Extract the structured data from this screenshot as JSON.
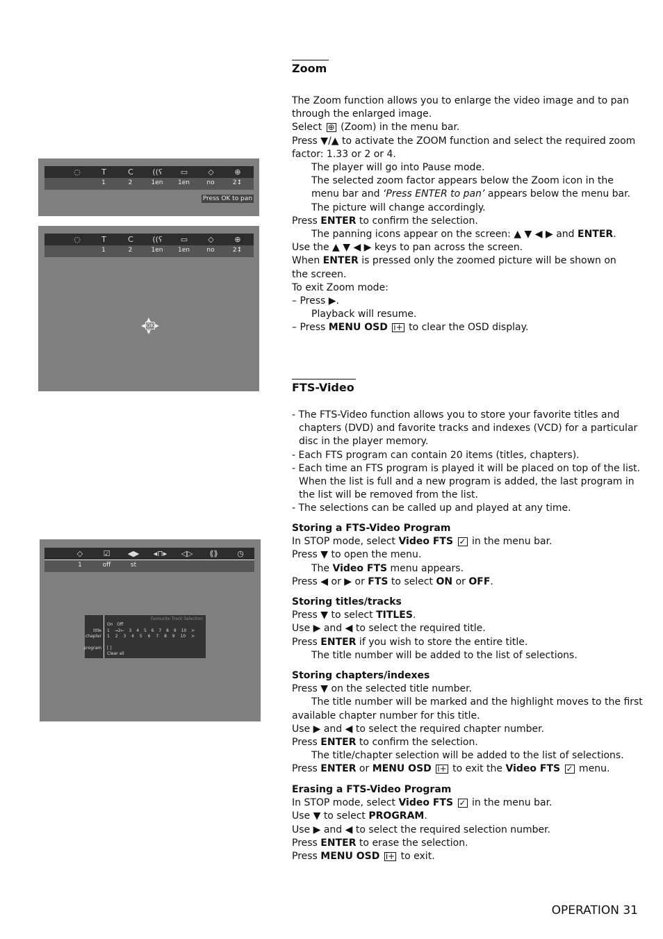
{
  "zoom": {
    "title": "Zoom",
    "lines": [
      [
        {
          "t": "The Zoom function allows you to enlarge the video image and to pan"
        }
      ],
      [
        {
          "t": "through the enlarged image."
        }
      ],
      [
        {
          "t": "Select "
        },
        {
          "icon": "zoom-icon",
          "t": "⊕"
        },
        {
          "t": " (Zoom) in the menu bar."
        }
      ],
      [
        {
          "t": "Press ▼/▲ to activate the ZOOM function and select the required zoom"
        }
      ],
      [
        {
          "t": "factor: 1.33 or 2 or 4."
        }
      ],
      [
        {
          "ind": 1,
          "t": "The player will go into Pause mode."
        }
      ],
      [
        {
          "ind": 1,
          "t": "The selected zoom factor appears below the Zoom icon in the"
        }
      ],
      [
        {
          "ind": 1,
          "t": "menu bar and "
        },
        {
          "t": "‘Press ENTER to pan’",
          "s": "i"
        },
        {
          "t": " appears below the menu bar."
        }
      ],
      [
        {
          "ind": 1,
          "t": "The picture will change accordingly."
        }
      ],
      [
        {
          "t": "Press "
        },
        {
          "t": "ENTER",
          "s": "b"
        },
        {
          "t": " to confirm the selection."
        }
      ],
      [
        {
          "ind": 1,
          "t": "The panning icons appear on the screen: ▲ ▼ ◀ ▶ and "
        },
        {
          "t": "ENTER",
          "s": "b"
        },
        {
          "t": "."
        }
      ],
      [
        {
          "t": "Use the ▲ ▼ ◀ ▶ keys to pan across the screen."
        }
      ],
      [
        {
          "t": "When "
        },
        {
          "t": "ENTER",
          "s": "b"
        },
        {
          "t": " is pressed only the zoomed picture will be shown on"
        }
      ],
      [
        {
          "t": "the screen."
        }
      ],
      [
        {
          "t": "To exit Zoom mode:"
        }
      ],
      [
        {
          "t": "– Press ▶."
        }
      ],
      [
        {
          "ind": 1,
          "t": " Playback will resume."
        }
      ],
      [
        {
          "t": "– Press "
        },
        {
          "t": "MENU OSD",
          "s": "b"
        },
        {
          "t": " "
        },
        {
          "icon": "osd-icon",
          "t": "i+"
        },
        {
          "t": " to clear the OSD display."
        }
      ]
    ]
  },
  "fts": {
    "title": "FTS-Video",
    "intro": [
      [
        {
          "t": "- The FTS-Video function allows you to store your favorite titles and"
        }
      ],
      [
        {
          "ind": 2,
          "t": "chapters (DVD) and favorite tracks and indexes (VCD) for a particular"
        }
      ],
      [
        {
          "ind": 2,
          "t": "disc in the player memory."
        }
      ],
      [
        {
          "t": "- Each FTS program can contain 20 items (titles, chapters)."
        }
      ],
      [
        {
          "t": "- Each time an FTS program is played it will be placed on top of the list."
        }
      ],
      [
        {
          "ind": 2,
          "t": "When the list is full and a new program is added, the last program in"
        }
      ],
      [
        {
          "ind": 2,
          "t": "the list will be removed from the list."
        }
      ],
      [
        {
          "t": "- The selections can be called up and played at any time."
        }
      ]
    ],
    "sections": [
      {
        "title": "Storing a FTS-Video Program",
        "lines": [
          [
            {
              "t": "In STOP mode, select "
            },
            {
              "t": "Video FTS",
              "s": "b"
            },
            {
              "t": " "
            },
            {
              "icon": "checkbox-icon",
              "t": "✓"
            },
            {
              "t": " in the menu bar."
            }
          ],
          [
            {
              "t": "Press ▼ to open the menu."
            }
          ],
          [
            {
              "ind": 1,
              "t": " The "
            },
            {
              "t": "Video FTS",
              "s": "b"
            },
            {
              "t": " menu appears."
            }
          ],
          [
            {
              "t": "Press ◀ or ▶ or "
            },
            {
              "t": "FTS",
              "s": "b"
            },
            {
              "t": " to select "
            },
            {
              "t": "ON",
              "s": "b"
            },
            {
              "t": " or "
            },
            {
              "t": "OFF",
              "s": "b"
            },
            {
              "t": "."
            }
          ]
        ]
      },
      {
        "title": "Storing titles/tracks",
        "lines": [
          [
            {
              "t": "Press ▼ to select "
            },
            {
              "t": "TITLES",
              "s": "b"
            },
            {
              "t": "."
            }
          ],
          [
            {
              "t": "Use ▶ and ◀ to select the required title."
            }
          ],
          [
            {
              "t": "Press "
            },
            {
              "t": "ENTER",
              "s": "b"
            },
            {
              "t": " if you wish to store the entire title."
            }
          ],
          [
            {
              "ind": 1,
              "t": " The title number will be added to the list of selections."
            }
          ]
        ]
      },
      {
        "title": "Storing chapters/indexes",
        "lines": [
          [
            {
              "t": "Press ▼ on the selected title number."
            }
          ],
          [
            {
              "ind": 1,
              "t": " The title number will be marked and the highlight moves to the first"
            }
          ],
          [
            {
              "t": "available chapter number for this title."
            }
          ],
          [
            {
              "t": "Use ▶ and ◀ to select the required chapter number."
            }
          ],
          [
            {
              "t": "Press "
            },
            {
              "t": "ENTER",
              "s": "b"
            },
            {
              "t": " to confirm the selection."
            }
          ],
          [
            {
              "ind": 1,
              "t": " The title/chapter selection will be added to the list of selections."
            }
          ],
          [
            {
              "t": "Press "
            },
            {
              "t": "ENTER",
              "s": "b"
            },
            {
              "t": " or "
            },
            {
              "t": "MENU OSD",
              "s": "b"
            },
            {
              "t": " "
            },
            {
              "icon": "osd-icon",
              "t": "i+"
            },
            {
              "t": " to exit the "
            },
            {
              "t": "Video FTS",
              "s": "b"
            },
            {
              "t": " "
            },
            {
              "icon": "checkbox-icon",
              "t": "✓"
            },
            {
              "t": " menu."
            }
          ]
        ]
      },
      {
        "title": "Erasing a FTS-Video Program",
        "lines": [
          [
            {
              "t": "In STOP mode, select "
            },
            {
              "t": "Video FTS",
              "s": "b"
            },
            {
              "t": " "
            },
            {
              "icon": "checkbox-icon",
              "t": "✓"
            },
            {
              "t": " in the menu bar."
            }
          ],
          [
            {
              "t": "Use ▼ to select "
            },
            {
              "t": "PROGRAM",
              "s": "b"
            },
            {
              "t": "."
            }
          ],
          [
            {
              "t": "Use ▶ and ◀ to select the required selection number."
            }
          ],
          [
            {
              "t": "Press "
            },
            {
              "t": "ENTER",
              "s": "b"
            },
            {
              "t": " to erase the selection."
            }
          ],
          [
            {
              "t": "Press "
            },
            {
              "t": "MENU OSD",
              "s": "b"
            },
            {
              "t": " "
            },
            {
              "icon": "osd-icon",
              "t": "i+"
            },
            {
              "t": " to exit."
            }
          ]
        ]
      }
    ]
  },
  "screens": {
    "menubar_values": [
      "1",
      "2",
      "1en",
      "1en",
      "no",
      "2↕"
    ],
    "menubar_icons": [
      "disc-icon",
      "title-icon",
      "chapter-icon",
      "audio-icon",
      "subtitle-icon",
      "angle-icon",
      "zoom-icon"
    ],
    "menubar_glyphs": [
      "◌",
      "T",
      "C",
      "((ʕ",
      "▭",
      "◇",
      "⊕"
    ],
    "pan_hint": "Press OK to pan",
    "ok_label": "OK",
    "fts_icons": [
      "◇",
      "☑",
      "◀▶",
      "◂⊓▸",
      "◁▷",
      "⟪⟫",
      "◷"
    ],
    "fts_values": [
      "1",
      "off",
      "st"
    ],
    "fts_panel": {
      "title": "Favourite Track Selection",
      "on": "On",
      "off": "Off",
      "row_title": "title",
      "row_chapter": "chapter",
      "row_program": "program",
      "title_nums": "1 →2← 3 4 5 6 7 8 9 10 >",
      "chapter_nums": "1 2 3 4 5 6 7 8 9 10 >",
      "program_value": "[ ]",
      "clear_all": "Clear all"
    }
  },
  "footer": "OPERATION 31"
}
